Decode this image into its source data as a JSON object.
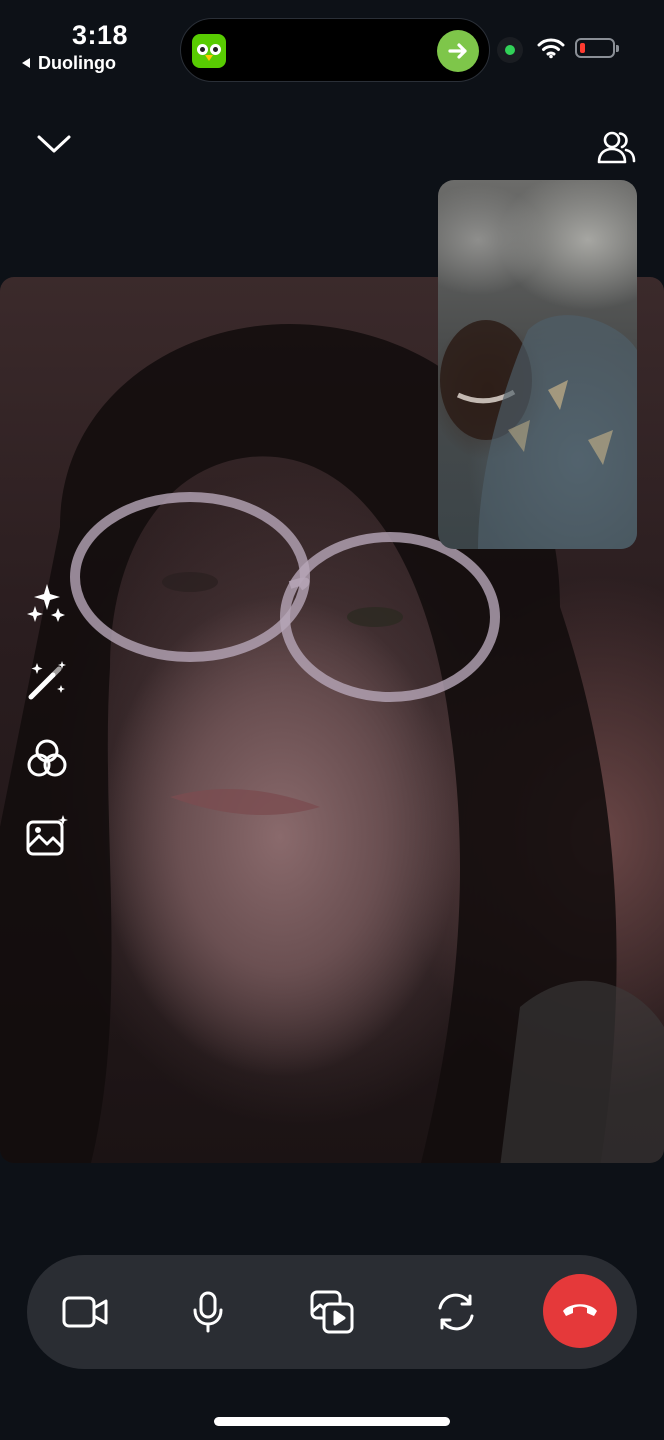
{
  "status_bar": {
    "time": "3:18",
    "back_app": "Duolingo",
    "back_icon": "back-triangle-icon",
    "live_activity_icon": "duolingo-owl-icon",
    "live_activity_action_icon": "arrow-right-icon",
    "camera_indicator_color": "#31d158",
    "wifi_icon": "wifi-icon",
    "battery_level": 0.1,
    "battery_color": "#ff3b30"
  },
  "header": {
    "collapse_icon": "chevron-down-icon",
    "participants_icon": "participants-icon"
  },
  "side_tools": [
    {
      "name": "effects",
      "icon": "sparkles-icon"
    },
    {
      "name": "magic",
      "icon": "magic-wand-icon"
    },
    {
      "name": "filters",
      "icon": "filters-icon"
    },
    {
      "name": "background",
      "icon": "background-image-icon"
    }
  ],
  "controls": [
    {
      "name": "video",
      "icon": "video-camera-icon"
    },
    {
      "name": "microphone",
      "icon": "microphone-icon"
    },
    {
      "name": "share",
      "icon": "media-share-icon"
    },
    {
      "name": "flip-camera",
      "icon": "flip-camera-icon"
    },
    {
      "name": "end-call",
      "icon": "end-call-icon",
      "color": "#e5393a"
    }
  ]
}
